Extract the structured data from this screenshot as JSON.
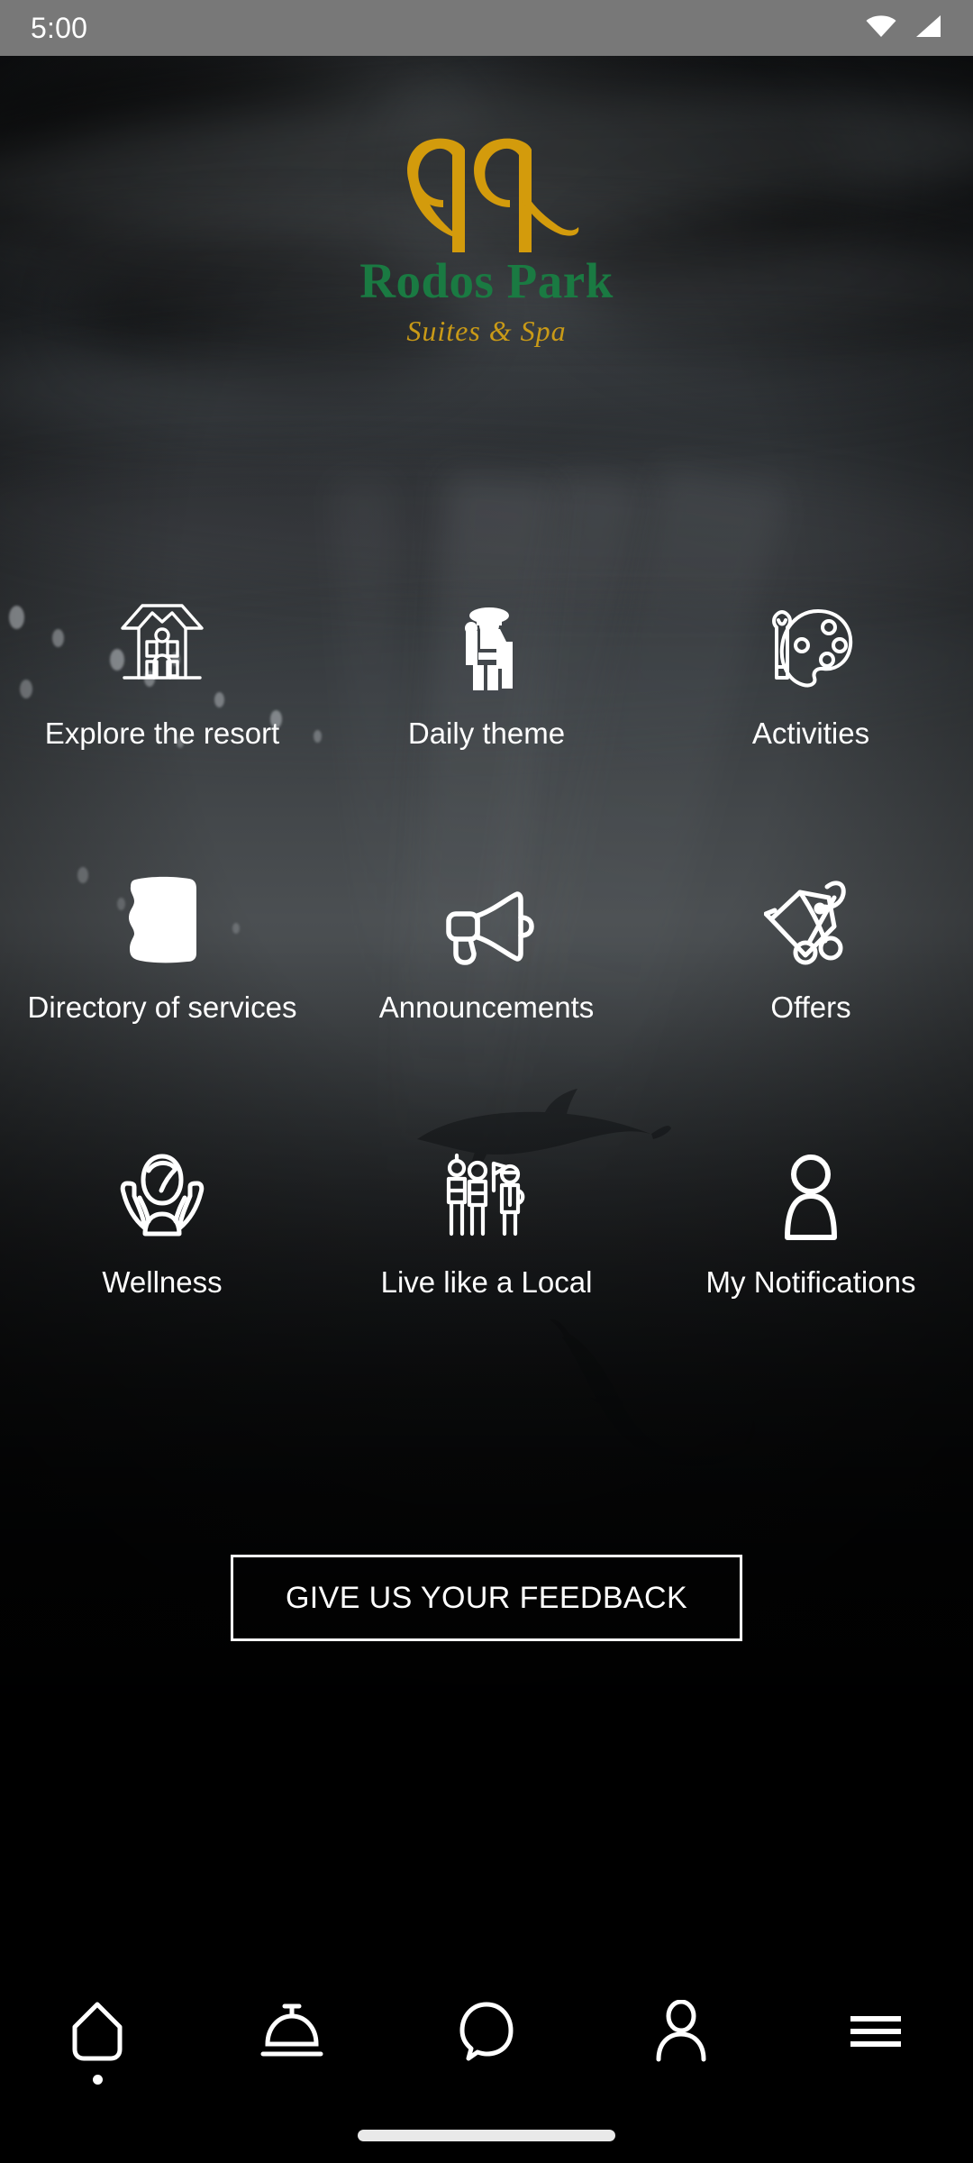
{
  "status_bar": {
    "time": "5:00",
    "icons": [
      "wifi-icon",
      "cellular-signal-icon"
    ]
  },
  "brand": {
    "monogram": "RR",
    "name": "Rodos Park",
    "tagline": "Suites & Spa",
    "colors": {
      "monogram_gold": "#d39b0c",
      "name_green": "#1a7a42",
      "tagline_gold": "#c99a17"
    }
  },
  "menu": {
    "rows": [
      [
        {
          "label": "Explore the resort",
          "icon": "villa-house-icon"
        },
        {
          "label": "Daily theme",
          "icon": "person-with-hat-icon"
        },
        {
          "label": "Activities",
          "icon": "paint-palette-icon"
        }
      ],
      [
        {
          "label": "Directory of services",
          "icon": "book-solid-icon"
        },
        {
          "label": "Announcements",
          "icon": "megaphone-icon"
        },
        {
          "label": "Offers",
          "icon": "price-tag-scissors-icon"
        }
      ],
      [
        {
          "label": "Wellness",
          "icon": "head-in-hands-icon"
        },
        {
          "label": "Live like a Local",
          "icon": "people-group-flag-icon"
        },
        {
          "label": "My Notifications",
          "icon": "person-icon"
        }
      ]
    ]
  },
  "feedback": {
    "label": "GIVE US YOUR FEEDBACK"
  },
  "bottom_nav": {
    "items": [
      {
        "name": "home",
        "icon": "home-icon",
        "active": true
      },
      {
        "name": "room-service",
        "icon": "service-bell-icon",
        "active": false
      },
      {
        "name": "chat",
        "icon": "chat-bubble-icon",
        "active": false
      },
      {
        "name": "profile",
        "icon": "person-outline-icon",
        "active": false
      },
      {
        "name": "menu",
        "icon": "hamburger-menu-icon",
        "active": false
      }
    ]
  },
  "theme": {
    "background": "#000000",
    "foreground": "#ffffff",
    "status_bar_bg": "#787878"
  }
}
